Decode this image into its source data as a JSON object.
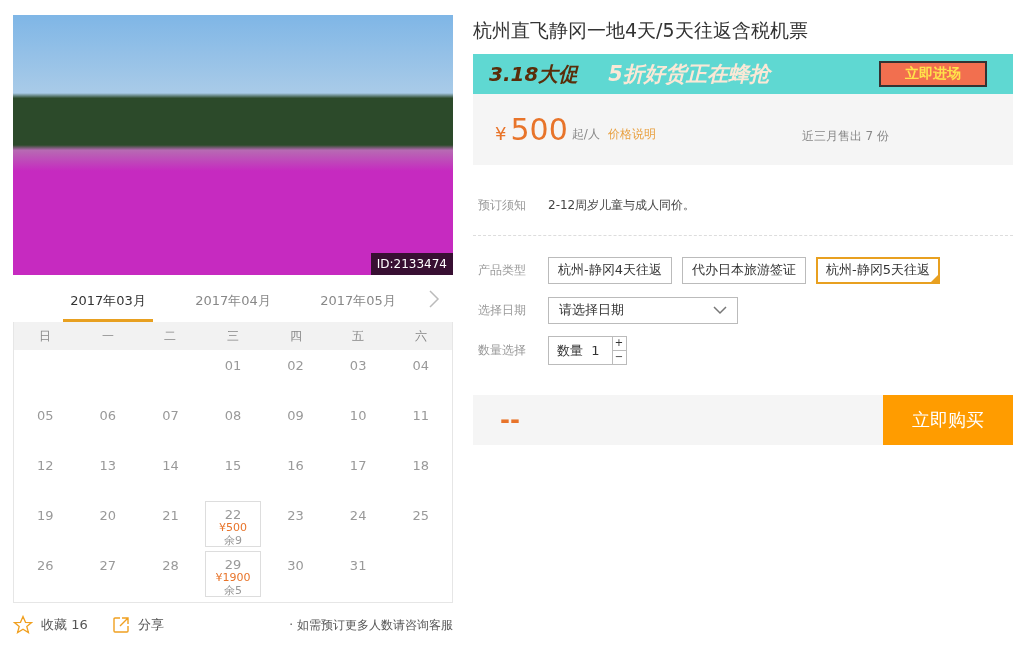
{
  "gallery": {
    "photo_id": "ID:2133474"
  },
  "calendar": {
    "months": [
      {
        "label": "2017年03月",
        "selected": true
      },
      {
        "label": "2017年04月",
        "selected": false
      },
      {
        "label": "2017年05月",
        "selected": false
      }
    ],
    "weekdays": [
      "日",
      "一",
      "二",
      "三",
      "四",
      "五",
      "六"
    ],
    "days": [
      {
        "kind": "blank"
      },
      {
        "kind": "blank"
      },
      {
        "kind": "blank"
      },
      {
        "day": "01"
      },
      {
        "day": "02"
      },
      {
        "day": "03"
      },
      {
        "day": "04"
      },
      {
        "day": "05"
      },
      {
        "day": "06"
      },
      {
        "day": "07"
      },
      {
        "day": "08"
      },
      {
        "day": "09"
      },
      {
        "day": "10"
      },
      {
        "day": "11"
      },
      {
        "day": "12"
      },
      {
        "day": "13"
      },
      {
        "day": "14"
      },
      {
        "day": "15"
      },
      {
        "day": "16"
      },
      {
        "day": "17"
      },
      {
        "day": "18"
      },
      {
        "day": "19"
      },
      {
        "day": "20"
      },
      {
        "day": "21"
      },
      {
        "kind": "priced",
        "day": "22",
        "price": "¥500",
        "remaining": "余9"
      },
      {
        "day": "23"
      },
      {
        "day": "24"
      },
      {
        "day": "25"
      },
      {
        "day": "26"
      },
      {
        "day": "27"
      },
      {
        "day": "28"
      },
      {
        "kind": "priced",
        "day": "29",
        "price": "¥1900",
        "remaining": "余5"
      },
      {
        "day": "30"
      },
      {
        "day": "31"
      }
    ]
  },
  "footer": {
    "favorite": "收藏 16",
    "share": "分享",
    "note": "· 如需预订更多人数请咨询客服"
  },
  "product": {
    "title": "杭州直飞静冈一地4天/5天往返含税机票",
    "banner": {
      "tag": "3.18大促",
      "slogan": "5折好货正在蜂抢",
      "cta": "立即进场"
    },
    "price": {
      "currency": "¥",
      "amount": "500",
      "unit": "起/人",
      "note_link": "价格说明",
      "sold": "近三月售出 7 份"
    },
    "notice": {
      "label": "预订须知",
      "text": "2-12周岁儿童与成人同价。"
    },
    "types": {
      "label": "产品类型",
      "options": [
        {
          "label": "杭州-静冈4天往返",
          "selected": false
        },
        {
          "label": "代办日本旅游签证",
          "selected": false
        },
        {
          "label": "杭州-静冈5天往返",
          "selected": true
        }
      ]
    },
    "date": {
      "label": "选择日期",
      "placeholder": "请选择日期"
    },
    "quantity": {
      "label": "数量选择",
      "prefix": "数量",
      "value": "1",
      "plus": "+",
      "minus": "−"
    },
    "total": "--",
    "buy": "立即购买"
  }
}
